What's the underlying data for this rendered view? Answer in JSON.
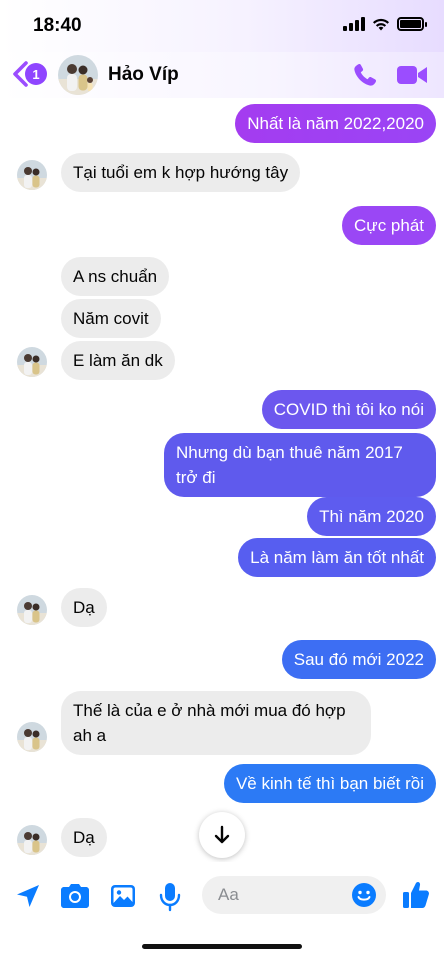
{
  "status": {
    "time": "18:40"
  },
  "header": {
    "back_count": "1",
    "contact_name": "Hảo Víp"
  },
  "messages": [
    {
      "from": "me",
      "text": "Nhất là năm 2022,2020"
    },
    {
      "from": "them",
      "text": "Tại tuổi em k hợp hướng tây"
    },
    {
      "from": "me",
      "text": "Cực phát"
    },
    {
      "from": "them",
      "text": "A ns chuẩn"
    },
    {
      "from": "them",
      "text": "Năm covit"
    },
    {
      "from": "them",
      "text": "E làm ăn dk"
    },
    {
      "from": "me",
      "text": "COVID thì tôi ko nói"
    },
    {
      "from": "me",
      "text": "Nhưng dù bạn thuê năm 2017 trở đi"
    },
    {
      "from": "me",
      "text": "Thì năm 2020"
    },
    {
      "from": "me",
      "text": "Là năm làm ăn tốt nhất"
    },
    {
      "from": "them",
      "text": "Dạ"
    },
    {
      "from": "me",
      "text": "Sau đó mới 2022"
    },
    {
      "from": "them",
      "text": "Thế là của e ở nhà mới mua đó hợp ah a"
    },
    {
      "from": "me",
      "text": "Về kinh tế thì bạn biết rồi"
    },
    {
      "from": "them",
      "text": "Dạ"
    }
  ],
  "composer": {
    "placeholder": "Aa"
  },
  "icons": {
    "back": "chevron-left-icon",
    "call": "phone-icon",
    "video": "video-camera-icon",
    "scroll": "arrow-down-icon",
    "location": "navigation-arrow-icon",
    "camera": "camera-icon",
    "gallery": "image-icon",
    "mic": "microphone-icon",
    "emoji": "emoji-icon",
    "like": "thumbs-up-icon"
  },
  "colors": {
    "accent": "#0a7cff",
    "purple": "#8f45ff",
    "incoming_bubble": "#ececec"
  }
}
